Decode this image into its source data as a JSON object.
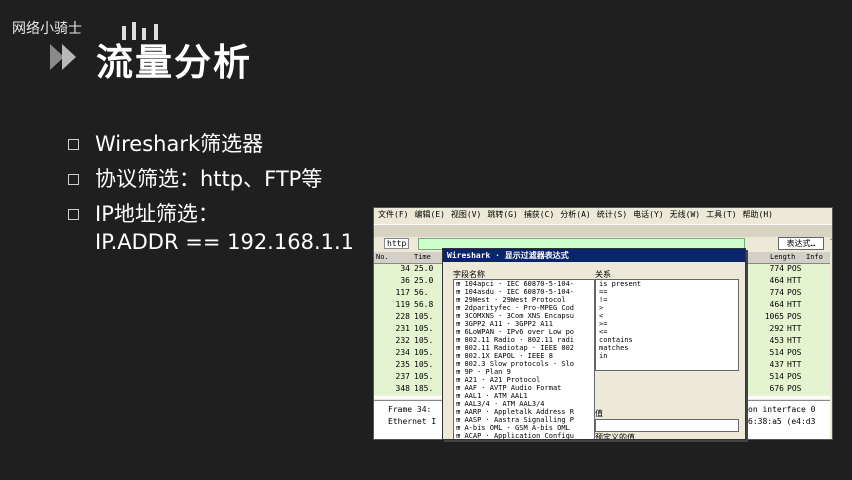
{
  "watermark": "网络小骑士",
  "title": "流量分析",
  "bullets": [
    "Wireshark筛选器",
    "协议筛选：http、FTP等",
    "IP地址筛选：",
    "IP.ADDR == 192.168.1.1"
  ],
  "wireshark": {
    "menu": [
      "文件(F)",
      "编辑(E)",
      "视图(V)",
      "跳转(G)",
      "捕获(C)",
      "分析(A)",
      "统计(S)",
      "电话(Y)",
      "无线(W)",
      "工具(T)",
      "帮助(H)"
    ],
    "filter_label": "http",
    "filter_button": "表达式…",
    "columns": {
      "no": "No.",
      "time": "Time",
      "length": "Length",
      "info": "Info"
    },
    "rows": [
      {
        "no": "34",
        "time": "25.0",
        "len": "774",
        "info": "POS"
      },
      {
        "no": "36",
        "time": "25.0",
        "len": "464",
        "info": "HTT"
      },
      {
        "no": "117",
        "time": "56.",
        "len": "774",
        "info": "POS"
      },
      {
        "no": "119",
        "time": "56.8",
        "len": "464",
        "info": "HTT"
      },
      {
        "no": "228",
        "time": "105.",
        "len": "1065",
        "info": "POS"
      },
      {
        "no": "231",
        "time": "105.",
        "len": "292",
        "info": "HTT"
      },
      {
        "no": "232",
        "time": "105.",
        "len": "453",
        "info": "HTT"
      },
      {
        "no": "234",
        "time": "105.",
        "len": "514",
        "info": "POS"
      },
      {
        "no": "235",
        "time": "105.",
        "len": "437",
        "info": "HTT"
      },
      {
        "no": "237",
        "time": "105.",
        "len": "514",
        "info": "POS"
      },
      {
        "no": "348",
        "time": "185.",
        "len": "676",
        "info": "POS"
      }
    ],
    "detail": [
      {
        "left": "Frame 34:",
        "right": "on interface 0"
      },
      {
        "left": "Ethernet I",
        "right": "6:38:a5 (e4:d3"
      }
    ]
  },
  "dialog": {
    "title": "Wireshark · 显示过滤器表达式",
    "fields_label": "字段名称",
    "relations_label": "关系",
    "value_label": "值",
    "predef_label": "预定义的值",
    "fields": [
      "104apci · IEC 60870-5-104-",
      "104asdu · IEC 60870-5-104-",
      "29West · 29West Protocol",
      "2dparityfec · Pro-MPEG Cod",
      "3COMXNS · 3Com XNS Encapsu",
      "3GPP2 A11 · 3GPP2 A11",
      "6LoWPAN · IPv6 over Low po",
      "802.11 Radio · 802.11 radi",
      "802.11 Radiotap · IEEE 802",
      "802.1X EAPOL · IEEE 8",
      "802.3 Slow protocols · Slo",
      "9P · Plan 9",
      "A21 · A21 Protocol",
      "AAF · AVTP Audio Format",
      "AAL1 · ATM AAL1",
      "AAL3/4 · ATM AAL3/4",
      "AARP · Appletalk Address R",
      "AASP · Aastra Signalling P",
      "A-bis OML · GSM A-bis OML",
      "ACAP · Application Configu"
    ],
    "relations": [
      "is present",
      "==",
      "!=",
      ">",
      "<",
      ">=",
      "<=",
      "contains",
      "matches",
      "in"
    ]
  }
}
